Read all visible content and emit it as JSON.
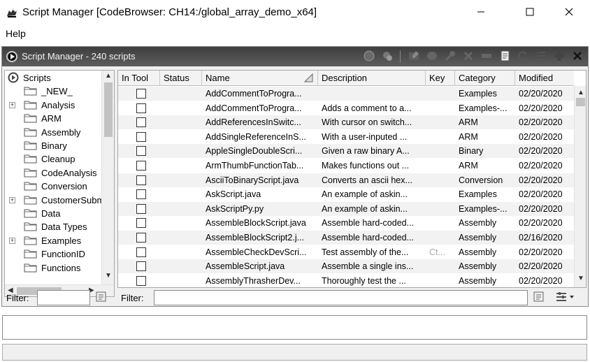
{
  "window": {
    "title": "Script Manager [CodeBrowser: CH14:/global_array_demo_x64]",
    "app_icon": "ghidra-dragon-icon",
    "controls": [
      "minimize-icon",
      "maximize-icon",
      "close-icon"
    ]
  },
  "menu": {
    "items": [
      "Help"
    ]
  },
  "panel": {
    "title": "Script Manager - 240 scripts",
    "toolbar_icons": [
      "run-script-icon",
      "run-last-script-icon",
      "edit-script-icon",
      "eclipse-edit-icon",
      "key-binding-icon",
      "delete-script-icon",
      "rename-icon",
      "new-script-icon",
      "refresh-icon",
      "script-directories-icon",
      "create-new-icon",
      "close-panel-icon"
    ]
  },
  "tree": {
    "root": "Scripts",
    "items": [
      {
        "label": "_NEW_",
        "expandable": false
      },
      {
        "label": "Analysis",
        "expandable": true
      },
      {
        "label": "ARM",
        "expandable": false
      },
      {
        "label": "Assembly",
        "expandable": false
      },
      {
        "label": "Binary",
        "expandable": false
      },
      {
        "label": "Cleanup",
        "expandable": false
      },
      {
        "label": "CodeAnalysis",
        "expandable": false
      },
      {
        "label": "Conversion",
        "expandable": false
      },
      {
        "label": "CustomerSubm",
        "expandable": true
      },
      {
        "label": "Data",
        "expandable": false
      },
      {
        "label": "Data Types",
        "expandable": false
      },
      {
        "label": "Examples",
        "expandable": true
      },
      {
        "label": "FunctionID",
        "expandable": false
      },
      {
        "label": "Functions",
        "expandable": false
      }
    ]
  },
  "table": {
    "columns": [
      "In Tool",
      "Status",
      "Name",
      "Description",
      "Key",
      "Category",
      "Modified"
    ],
    "rows": [
      {
        "name": "AddCommentToProgra...",
        "description": "",
        "key": "",
        "category": "Examples",
        "modified": "02/20/2020"
      },
      {
        "name": "AddCommentToProgra...",
        "description": "Adds a comment to a...",
        "key": "",
        "category": "Examples-...",
        "modified": "02/20/2020"
      },
      {
        "name": "AddReferencesInSwitc...",
        "description": "With cursor on switch...",
        "key": "",
        "category": "ARM",
        "modified": "02/20/2020"
      },
      {
        "name": "AddSingleReferenceInS...",
        "description": "With a user-inputed ...",
        "key": "",
        "category": "ARM",
        "modified": "02/20/2020"
      },
      {
        "name": "AppleSingleDoubleScri...",
        "description": "Given a raw binary A...",
        "key": "",
        "category": "Binary",
        "modified": "02/20/2020"
      },
      {
        "name": "ArmThumbFunctionTab...",
        "description": "Makes functions out ...",
        "key": "",
        "category": "ARM",
        "modified": "02/20/2020"
      },
      {
        "name": "AsciiToBinaryScript.java",
        "description": "Converts an ascii hex...",
        "key": "",
        "category": "Conversion",
        "modified": "02/20/2020"
      },
      {
        "name": "AskScript.java",
        "description": "An example of askin...",
        "key": "",
        "category": "Examples",
        "modified": "02/20/2020"
      },
      {
        "name": "AskScriptPy.py",
        "description": "An example of askin...",
        "key": "",
        "category": "Examples-...",
        "modified": "02/20/2020"
      },
      {
        "name": "AssembleBlockScript.java",
        "description": "Assemble hard-coded...",
        "key": "",
        "category": "Assembly",
        "modified": "02/20/2020"
      },
      {
        "name": "AssembleBlockScript2.j...",
        "description": "Assemble hard-coded...",
        "key": "",
        "category": "Assembly",
        "modified": "02/16/2020"
      },
      {
        "name": "AssembleCheckDevScri...",
        "description": "Test assembly of the...",
        "key": "Ct...",
        "category": "Assembly",
        "modified": "02/20/2020"
      },
      {
        "name": "AssembleScript.java",
        "description": "Assemble a single ins...",
        "key": "",
        "category": "Assembly",
        "modified": "02/20/2020"
      },
      {
        "name": "AssemblyThrasherDev...",
        "description": "Thoroughly test the ...",
        "key": "",
        "category": "Assembly",
        "modified": "02/20/2020"
      }
    ]
  },
  "filters": {
    "tree_label": "Filter:",
    "tree_value": "",
    "table_label": "Filter:",
    "table_value": ""
  }
}
